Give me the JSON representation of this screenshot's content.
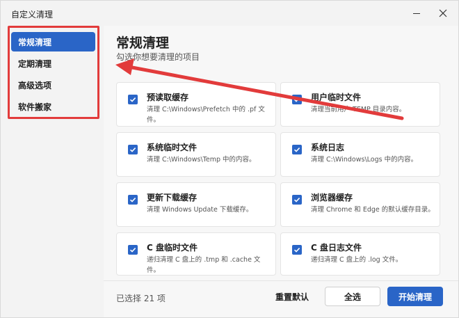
{
  "window": {
    "title": "自定义清理"
  },
  "sidebar": {
    "items": [
      {
        "label": "常规清理"
      },
      {
        "label": "定期清理"
      },
      {
        "label": "高级选项"
      },
      {
        "label": "软件搬家"
      }
    ]
  },
  "main": {
    "title": "常规清理",
    "subtitle": "勾选你想要清理的项目",
    "cards": [
      {
        "title": "预读取缓存",
        "description": "清理 C:\\Windows\\Prefetch 中的 .pf 文件。",
        "checked": true
      },
      {
        "title": "用户临时文件",
        "description": "清理当前用户 TEMP 目录内容。",
        "checked": true
      },
      {
        "title": "系统临时文件",
        "description": "清理 C:\\Windows\\Temp 中的内容。",
        "checked": true
      },
      {
        "title": "系统日志",
        "description": "清理 C:\\Windows\\Logs 中的内容。",
        "checked": true
      },
      {
        "title": "更新下载缓存",
        "description": "清理 Windows Update 下载缓存。",
        "checked": true
      },
      {
        "title": "浏览器缓存",
        "description": "清理 Chrome 和 Edge 的默认缓存目录。",
        "checked": true
      },
      {
        "title": "C 盘临时文件",
        "description": "递归清理 C 盘上的 .tmp 和 .cache 文件。",
        "checked": true
      },
      {
        "title": "C 盘日志文件",
        "description": "递归清理 C 盘上的 .log 文件。",
        "checked": true
      }
    ]
  },
  "footer": {
    "selected_count": "已选择 21 项",
    "reset_label": "重置默认",
    "select_all_label": "全选",
    "start_label": "开始清理"
  },
  "colors": {
    "accent": "#2a65c7",
    "annotation": "#e23b3b"
  }
}
